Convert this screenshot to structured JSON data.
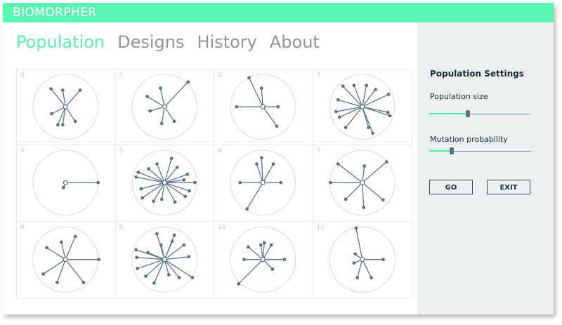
{
  "app": {
    "title": "BIOMORPHER"
  },
  "nav": {
    "tabs": [
      "Population",
      "Designs",
      "History",
      "About"
    ],
    "active": 0
  },
  "population": {
    "cells": [
      {
        "index": "0",
        "branches": [
          [
            -21,
            -26
          ],
          [
            -4,
            -24
          ],
          [
            21,
            -24
          ],
          [
            -20,
            10
          ],
          [
            -11,
            26
          ],
          [
            -4,
            26
          ],
          [
            14,
            21
          ]
        ]
      },
      {
        "index": "1",
        "branches": [
          [
            -25,
            -15
          ],
          [
            -6,
            -27
          ],
          [
            34,
            -36
          ],
          [
            -21,
            6
          ],
          [
            -4,
            24
          ],
          [
            14,
            21
          ]
        ]
      },
      {
        "index": "2",
        "branches": [
          [
            -20,
            -42
          ],
          [
            -2,
            -27
          ],
          [
            -38,
            0
          ],
          [
            22,
            0
          ],
          [
            20,
            28
          ]
        ]
      },
      {
        "index": "3",
        "branches": [
          [
            -28,
            -30
          ],
          [
            -12,
            -31
          ],
          [
            6,
            -31
          ],
          [
            19,
            -25
          ],
          [
            38,
            -18
          ],
          [
            -35,
            -10
          ],
          [
            -38,
            7
          ],
          [
            -33,
            15
          ],
          [
            -24,
            30
          ],
          [
            9,
            30
          ],
          [
            15,
            38
          ],
          [
            37,
            8
          ],
          [
            40,
            13
          ]
        ]
      },
      {
        "index": "4",
        "branches": [
          [
            47,
            0
          ],
          [
            -3,
            7
          ]
        ]
      },
      {
        "index": "5",
        "branches": [
          [
            -41,
            -8
          ],
          [
            -38,
            -15
          ],
          [
            -23,
            -20
          ],
          [
            -11,
            -27
          ],
          [
            10,
            -35
          ],
          [
            18,
            -22
          ],
          [
            33,
            -12
          ],
          [
            28,
            -4
          ],
          [
            44,
            0
          ],
          [
            36,
            12
          ],
          [
            30,
            20
          ],
          [
            15,
            28
          ],
          [
            -4,
            24
          ],
          [
            -16,
            27
          ],
          [
            -32,
            22
          ],
          [
            -34,
            9
          ]
        ]
      },
      {
        "index": "6",
        "branches": [
          [
            -9,
            -27
          ],
          [
            -2,
            -36
          ],
          [
            15,
            -27
          ],
          [
            -33,
            0
          ],
          [
            26,
            0
          ],
          [
            -23,
            38
          ]
        ]
      },
      {
        "index": "7",
        "branches": [
          [
            -35,
            -27
          ],
          [
            3,
            -24
          ],
          [
            35,
            -30
          ],
          [
            -46,
            0
          ],
          [
            -24,
            24
          ],
          [
            2,
            36
          ],
          [
            30,
            25
          ]
        ]
      },
      {
        "index": "8",
        "branches": [
          [
            -27,
            -17
          ],
          [
            -6,
            -25
          ],
          [
            14,
            -33
          ],
          [
            48,
            0
          ],
          [
            -32,
            21
          ],
          [
            -12,
            33
          ],
          [
            26,
            33
          ]
        ]
      },
      {
        "index": "9",
        "branches": [
          [
            -11,
            -37
          ],
          [
            -5,
            -21
          ],
          [
            11,
            -26
          ],
          [
            14,
            -35
          ],
          [
            28,
            -21
          ],
          [
            -41,
            -14
          ],
          [
            -24,
            -10
          ],
          [
            -40,
            -3
          ],
          [
            35,
            -4
          ],
          [
            -39,
            13
          ],
          [
            -27,
            24
          ],
          [
            -15,
            34
          ],
          [
            6,
            22
          ],
          [
            21,
            26
          ],
          [
            40,
            26
          ]
        ]
      },
      {
        "index": "10",
        "branches": [
          [
            -21,
            -18
          ],
          [
            -3,
            -21
          ],
          [
            2,
            -24
          ],
          [
            12,
            -21
          ],
          [
            -27,
            0
          ],
          [
            31,
            0
          ],
          [
            14,
            14
          ],
          [
            -35,
            35
          ]
        ]
      },
      {
        "index": "11",
        "branches": [
          [
            -9,
            -45
          ],
          [
            30,
            0
          ],
          [
            -10,
            -8
          ],
          [
            -12,
            5
          ],
          [
            -7,
            26
          ],
          [
            13,
            26
          ]
        ]
      }
    ]
  },
  "sidebar": {
    "title": "Population Settings",
    "sliders": [
      {
        "label": "Population size",
        "value": 0.38
      },
      {
        "label": "Mutation probability",
        "value": 0.22
      }
    ],
    "buttons": {
      "go": "GO",
      "exit": "EXIT"
    }
  },
  "colors": {
    "accent": "#5bf0b0",
    "titlebar": "#5bf5b3",
    "branch": "#5b7382",
    "circle": "#d6dadc"
  }
}
